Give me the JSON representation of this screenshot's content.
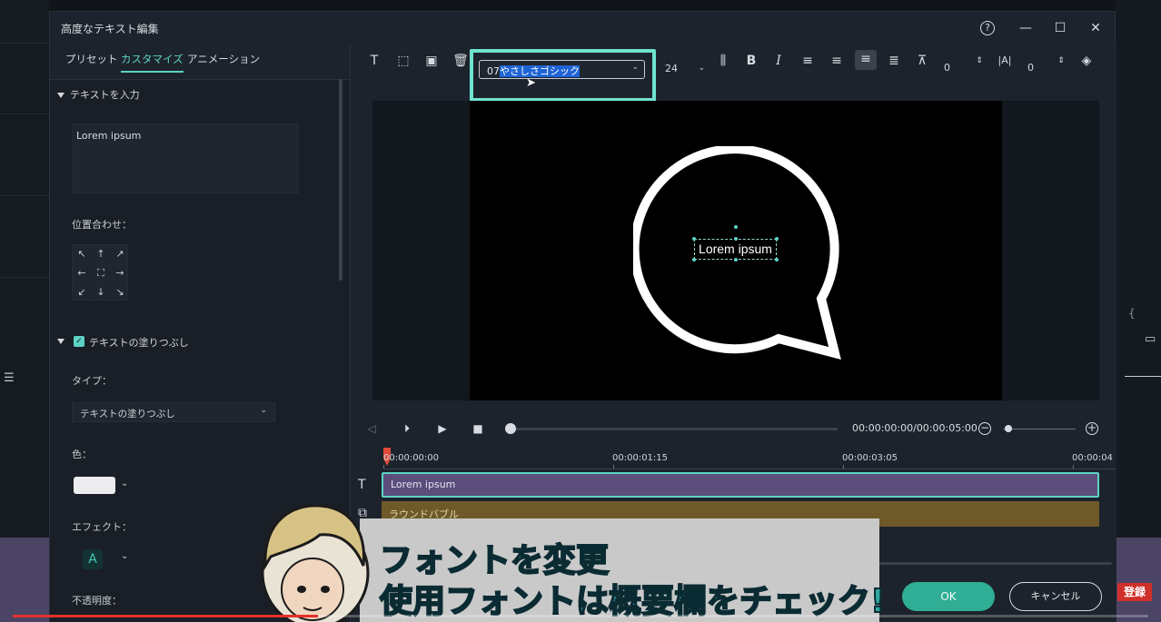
{
  "dialog": {
    "title": "高度なテキスト編集",
    "window_buttons": {
      "help": "?",
      "minimize": "—",
      "maximize": "☐",
      "close": "✕"
    }
  },
  "left_tabs": [
    {
      "label": "プリセット",
      "active": false
    },
    {
      "label": "カスタマイズ",
      "active": true
    },
    {
      "label": "アニメーション",
      "active": false
    }
  ],
  "text_section": {
    "header": "テキストを入力",
    "value": "Lorem ipsum",
    "align_label": "位置合わせ："
  },
  "fill_section": {
    "header": "テキストの塗りつぶし",
    "checked": true,
    "type_label": "タイプ：",
    "type_value": "テキストの塗りつぶし",
    "color_label": "色：",
    "color_value": "#ececee",
    "effect_label": "エフェクト：",
    "effect_glyph": "A",
    "opacity_label": "不透明度："
  },
  "toolbar": {
    "font_prefix": "07",
    "font_name": "やさしさゴシック",
    "font_size": "24",
    "char_spacing": "0",
    "line_spacing": "0"
  },
  "preview": {
    "text": "Lorem ipsum"
  },
  "playback": {
    "timecode": "00:00:00:00/00:00:05:00",
    "progress": 0
  },
  "timeline": {
    "ruler_labels": [
      "00:00:00:00",
      "00:00:01:15",
      "00:00:03:05",
      "00:00:04"
    ],
    "text_clip": "Lorem ipsum",
    "bubble_clip": "ラウンドバブル"
  },
  "buttons": {
    "ok": "OK",
    "cancel": "キャンセル"
  },
  "overlay": {
    "line1": "フォントを変更",
    "line2": "使用フォントは概要欄をチェック!",
    "subscribe": "登録"
  },
  "video_progress": 0.27
}
